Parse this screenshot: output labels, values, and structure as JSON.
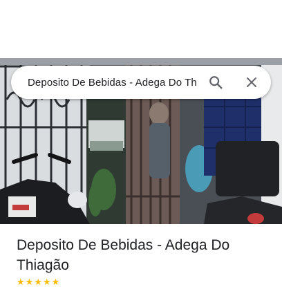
{
  "search": {
    "query": "Deposito De Bebidas - Adega Do Th"
  },
  "icons": {
    "search": "search-icon",
    "close": "close-icon"
  },
  "place": {
    "title": "Deposito De Bebidas - Adega Do Thiagão"
  },
  "colors": {
    "text": "#202124",
    "icon": "#5f6368",
    "star": "#fbbc04"
  }
}
